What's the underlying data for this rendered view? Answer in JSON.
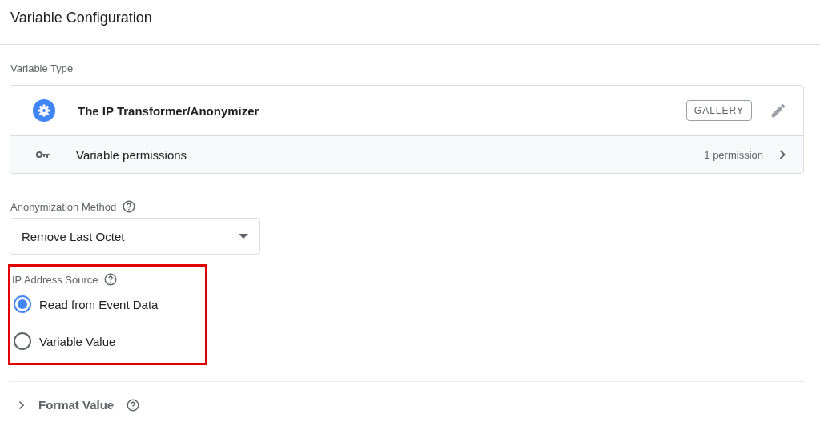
{
  "header": {
    "title": "Variable Configuration"
  },
  "variable_type": {
    "label": "Variable Type",
    "name": "The IP Transformer/Anonymizer",
    "gallery_button": "GALLERY",
    "permissions": {
      "label": "Variable permissions",
      "count": "1 permission"
    }
  },
  "anonymization_method": {
    "label": "Anonymization Method",
    "value": "Remove Last Octet"
  },
  "ip_address_source": {
    "label": "IP Address Source",
    "highlighted": true,
    "options": [
      {
        "label": "Read from Event Data",
        "selected": true
      },
      {
        "label": "Variable Value",
        "selected": false
      }
    ]
  },
  "format_value": {
    "label": "Format Value",
    "expanded": false
  }
}
